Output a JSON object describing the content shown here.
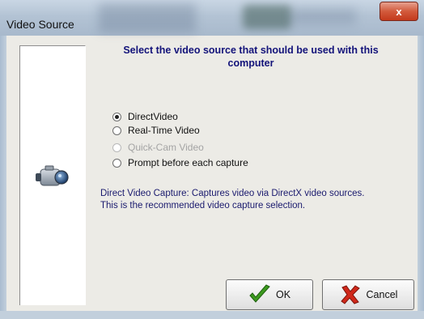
{
  "window": {
    "title": "Video Source",
    "close_symbol": "x"
  },
  "heading": "Select the video source that should be used with this computer",
  "options": [
    {
      "label": "DirectVideo",
      "checked": true,
      "disabled": false
    },
    {
      "label": "Real-Time Video",
      "checked": false,
      "disabled": false
    },
    {
      "label": "Quick-Cam Video",
      "checked": false,
      "disabled": true
    },
    {
      "label": "Prompt before each capture",
      "checked": false,
      "disabled": false
    }
  ],
  "description": {
    "line1": "Direct Video Capture:  Captures video via DirectX video sources.",
    "line2": "This is the recommended video capture selection."
  },
  "buttons": {
    "ok": "OK",
    "cancel": "Cancel"
  },
  "icons": {
    "sidebar": "video-camera-icon",
    "ok": "checkmark-icon",
    "cancel": "red-x-icon"
  },
  "colors": {
    "heading": "#13137a",
    "description": "#1a1a6e",
    "close_button": "#c43a1c",
    "ok_check": "#3c9a1e",
    "cancel_x": "#d0281a"
  }
}
